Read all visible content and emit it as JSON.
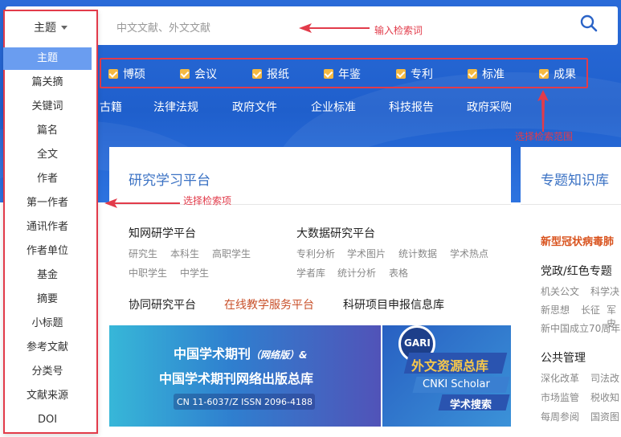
{
  "search": {
    "placeholder": "中文文献、外文文献"
  },
  "scope": {
    "items": [
      "博硕",
      "会议",
      "报纸",
      "年鉴",
      "专利",
      "标准",
      "成果"
    ]
  },
  "categories": [
    "古籍",
    "法律法规",
    "政府文件",
    "企业标准",
    "科技报告",
    "政府采购"
  ],
  "annotations": {
    "input_keyword": "输入检索词",
    "select_range": "选择检索范围",
    "select_field": "选择检索项"
  },
  "dropdown": {
    "header": "主题",
    "items": [
      "主题",
      "篇关摘",
      "关键词",
      "篇名",
      "全文",
      "作者",
      "第一作者",
      "通讯作者",
      "作者单位",
      "基金",
      "摘要",
      "小标题",
      "参考文献",
      "分类号",
      "文献来源",
      "DOI"
    ],
    "selected": "主题"
  },
  "research": {
    "title": "研究学习平台",
    "zhiwang": "知网研学平台",
    "zhiwang_subs": [
      "研究生",
      "本科生",
      "高职学生",
      "中职学生",
      "中学生"
    ],
    "bigdata": "大数据研究平台",
    "bigdata_subs": [
      "专利分析",
      "学术图片",
      "统计数据",
      "学术热点",
      "学者库",
      "统计分析",
      "表格"
    ],
    "collab": "协同研究平台",
    "online": "在线教学服务平台",
    "project": "科研项目申报信息库"
  },
  "banner_left": {
    "line1": "中国学术期刊",
    "line1_small": "（网络版）&",
    "line2": "中国学术期刊网络出版总库",
    "issn": "CN 11-6037/Z    ISSN 2096-4188"
  },
  "banner_right": {
    "gari": "GARI",
    "line1": "外文资源总库",
    "line2": "CNKI Scholar",
    "line3": "学术搜索"
  },
  "special": {
    "title": "专题知识库",
    "covid": "新型冠状病毒肺",
    "party": "党政/红色专题",
    "party_subs": [
      "机关公文",
      "科学决",
      "新思想",
      "长征",
      "军史",
      "新中国成立70周年"
    ],
    "public": "公共管理",
    "public_subs": [
      "深化改革",
      "司法改",
      "市场监管",
      "税收知",
      "每周参阅",
      "国资图"
    ]
  },
  "colors": {
    "accent_red": "#e23b4a",
    "brand_blue": "#1f5fcc",
    "selected_blue": "#6a9df0",
    "checkbox_orange": "#f5b942"
  }
}
